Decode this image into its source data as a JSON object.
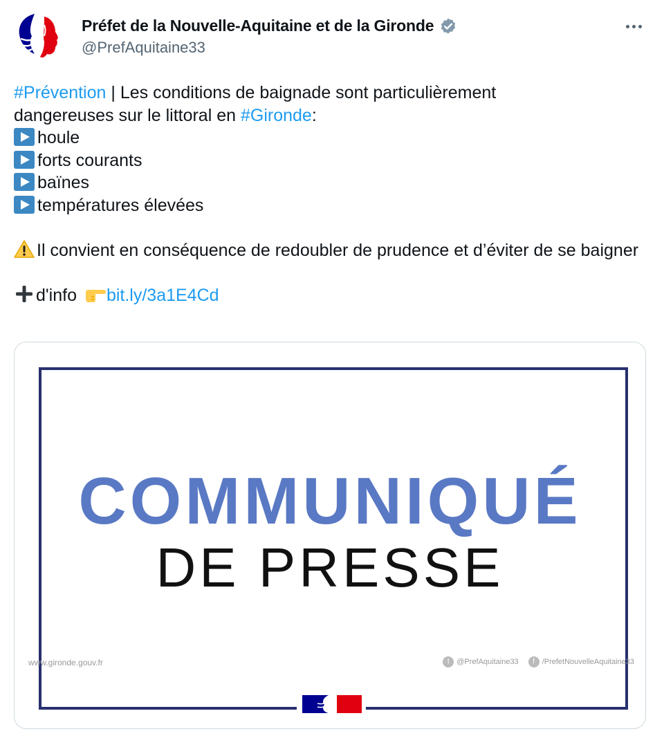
{
  "author": {
    "display_name": "Préfet de la Nouvelle-Aquitaine et de la Gironde",
    "handle": "@PrefAquitaine33"
  },
  "tweet": {
    "hashtag_prevention": "#Prévention",
    "line1_rest": " | Les conditions de baignade sont particulièrement",
    "line2_start": "dangereuses sur le littoral en ",
    "hashtag_gironde": "#Gironde",
    "colon": ":",
    "bullets": [
      "houle",
      "forts courants",
      "baïnes",
      "températures élevées"
    ],
    "warning_text": "Il convient en conséquence de redoubler de prudence et d’éviter de se baigner",
    "info_text": "d'info ",
    "link_text": "bit.ly/3a1E4Cd"
  },
  "media": {
    "title_line1": "COMMUNIQUÉ",
    "title_line2": "DE PRESSE",
    "website": "www.gironde.gouv.fr",
    "twitter": "@PrefAquitaine33",
    "facebook": "/PrefetNouvelleAquitaine33"
  },
  "colors": {
    "link": "#1d9bf0",
    "frame": "#28306e",
    "title_blue": "#5a79c4",
    "marianne_blue": "#000091",
    "marianne_red": "#e1000f"
  },
  "icons": [
    "marianne-logo",
    "verified-badge-icon",
    "more-options-icon",
    "play-button-icon",
    "warning-icon",
    "plus-icon",
    "pointing-hand-icon",
    "twitter-icon",
    "facebook-icon"
  ]
}
